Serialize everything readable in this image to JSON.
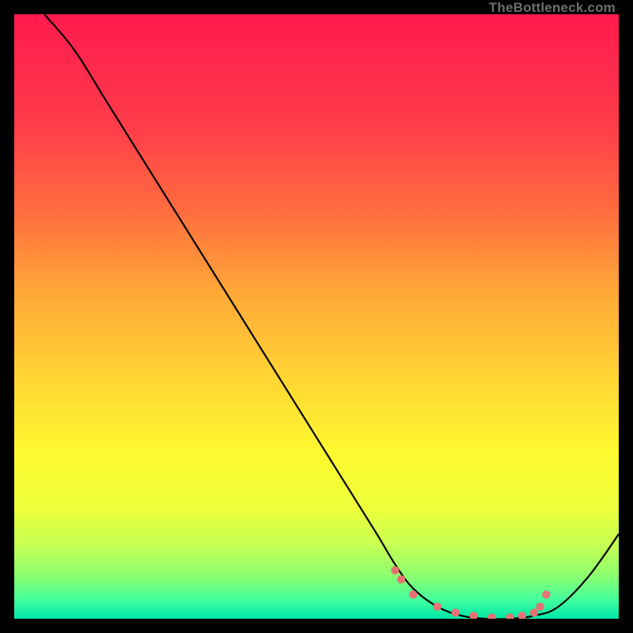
{
  "watermark": "TheBottleneck.com",
  "chart_data": {
    "type": "line",
    "title": "",
    "xlabel": "",
    "ylabel": "",
    "xlim": [
      0,
      100
    ],
    "ylim": [
      0,
      100
    ],
    "grid": false,
    "legend": false,
    "series": [
      {
        "name": "curve",
        "color": "#000000",
        "x": [
          5,
          10,
          15,
          20,
          25,
          30,
          35,
          40,
          45,
          50,
          55,
          60,
          63,
          66,
          70,
          74,
          78,
          82,
          86,
          90,
          95,
          100
        ],
        "y": [
          100,
          94,
          86,
          78,
          70,
          62,
          54,
          46,
          38,
          30,
          22,
          14,
          9,
          5,
          2,
          0.5,
          0,
          0,
          0.5,
          2,
          7,
          14
        ]
      }
    ],
    "markers": {
      "name": "optimal-range",
      "color": "#e57373",
      "x": [
        63,
        64,
        66,
        70,
        73,
        76,
        79,
        82,
        84,
        86,
        87,
        88
      ],
      "y": [
        8,
        6.5,
        4,
        2,
        1,
        0.5,
        0.2,
        0.2,
        0.5,
        1,
        2,
        4
      ]
    },
    "background_gradient": {
      "stops": [
        {
          "offset": 0.0,
          "color": "#ff1a4d"
        },
        {
          "offset": 0.18,
          "color": "#ff3b4a"
        },
        {
          "offset": 0.32,
          "color": "#ff6a3f"
        },
        {
          "offset": 0.46,
          "color": "#ffa837"
        },
        {
          "offset": 0.6,
          "color": "#ffd433"
        },
        {
          "offset": 0.72,
          "color": "#fff830"
        },
        {
          "offset": 0.82,
          "color": "#ecff3a"
        },
        {
          "offset": 0.88,
          "color": "#c4ff54"
        },
        {
          "offset": 0.93,
          "color": "#8aff70"
        },
        {
          "offset": 0.97,
          "color": "#3fff9e"
        },
        {
          "offset": 1.0,
          "color": "#00e6a8"
        }
      ]
    }
  }
}
